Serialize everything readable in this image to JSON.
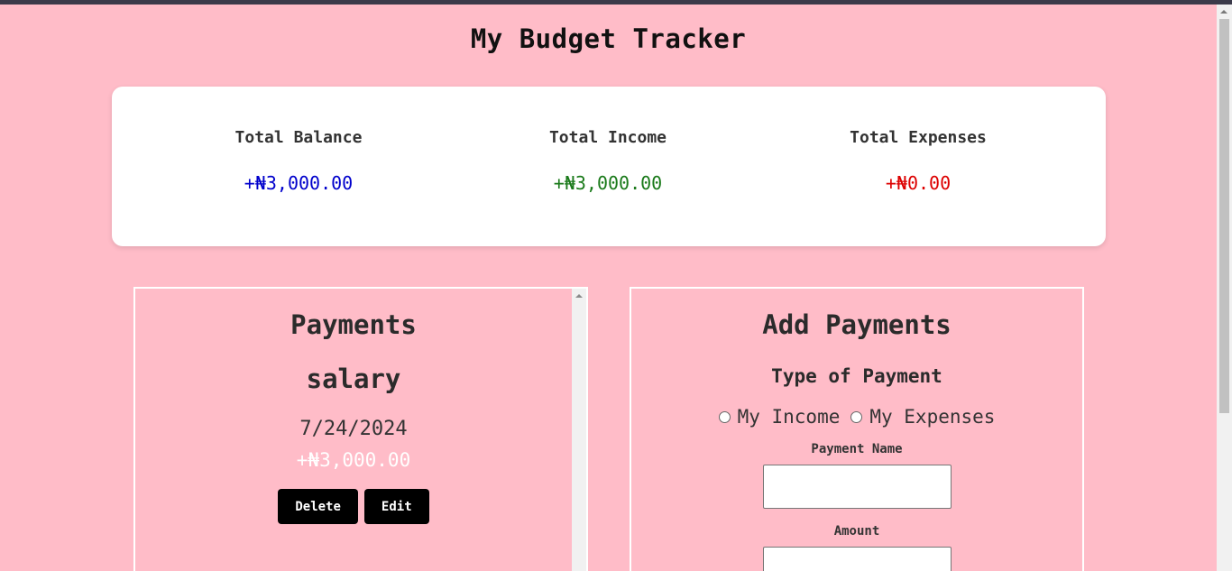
{
  "app": {
    "title": "My Budget Tracker"
  },
  "summary": {
    "balance_label": "Total Balance",
    "balance_value": "+₦3,000.00",
    "income_label": "Total Income",
    "income_value": "+₦3,000.00",
    "expenses_label": "Total Expenses",
    "expenses_value": "+₦0.00"
  },
  "payments": {
    "title": "Payments",
    "items": [
      {
        "name": "salary",
        "date": "7/24/2024",
        "amount": "+₦3,000.00",
        "delete_label": "Delete",
        "edit_label": "Edit"
      }
    ]
  },
  "add_payment": {
    "title": "Add Payments",
    "type_label": "Type of Payment",
    "options": [
      "My Income",
      "My Expenses"
    ],
    "name_label": "Payment Name",
    "name_value": "",
    "amount_label": "Amount",
    "amount_value": ""
  },
  "colors": {
    "background": "#ffbcc8",
    "balance": "#0000cc",
    "income": "#1a7a1a",
    "expenses": "#dd0000"
  }
}
